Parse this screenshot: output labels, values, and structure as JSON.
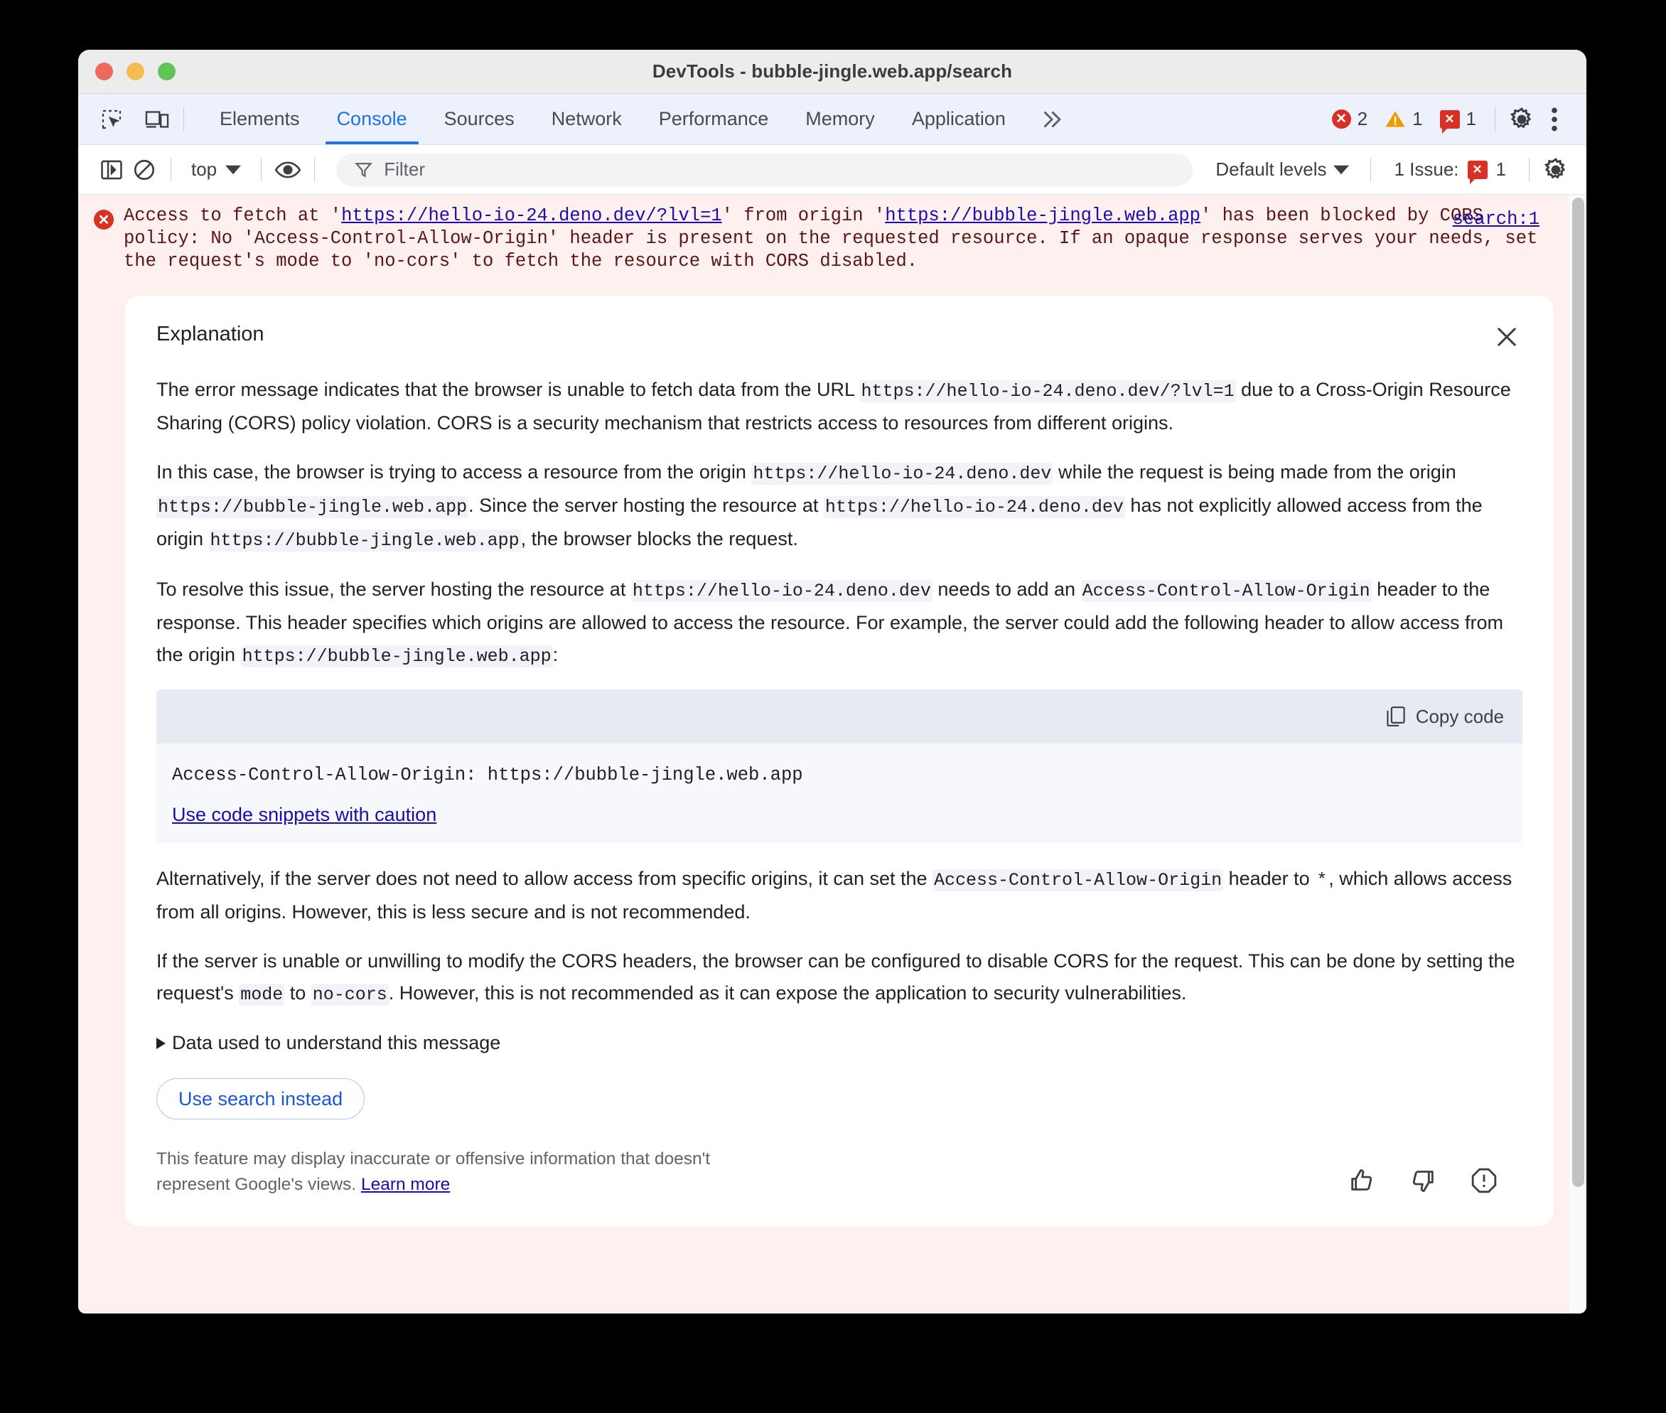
{
  "window": {
    "title": "DevTools - bubble-jingle.web.app/search",
    "traffic_lights": [
      "close",
      "minimize",
      "maximize"
    ]
  },
  "tabstrip": {
    "icons": [
      "inspect-element-icon",
      "device-toolbar-icon"
    ],
    "tabs": [
      {
        "label": "Elements",
        "active": false
      },
      {
        "label": "Console",
        "active": true
      },
      {
        "label": "Sources",
        "active": false
      },
      {
        "label": "Network",
        "active": false
      },
      {
        "label": "Performance",
        "active": false
      },
      {
        "label": "Memory",
        "active": false
      },
      {
        "label": "Application",
        "active": false
      }
    ],
    "more_label": "»",
    "counters": {
      "errors": "2",
      "warnings": "1",
      "issues": "1",
      "error_glyph": "✕",
      "issue_glyph": "✕"
    },
    "settings_label": "gear-icon",
    "overflow_label": "more-options-icon"
  },
  "console_toolbar": {
    "sidebar_toggle": "console-sidebar-icon",
    "clear_label": "clear-console-icon",
    "context": "top",
    "eye_label": "live-expressions-icon",
    "filter_placeholder": "Filter",
    "filter_value": "",
    "levels": "Default levels",
    "issues_text": "1 Issue:",
    "issues_count": "1",
    "settings_label": "settings-gear-icon"
  },
  "console_message": {
    "pre_url": "Access to fetch at '",
    "url": "https://hello-io-24.deno.dev/?lvl=1",
    "mid": "' from origin '",
    "origin": "https://bubble-jingle.web.app",
    "tail": "' has been blocked by CORS policy: No 'Access-Control-Allow-Origin' header is present on the requested resource. If an opaque response serves your needs, set the request's mode to 'no-cors' to fetch the resource with CORS disabled.",
    "source_link": "search:1"
  },
  "explanation": {
    "title": "Explanation",
    "close_label": "close-icon",
    "paragraphs": {
      "p1_a": "The error message indicates that the browser is unable to fetch data from the URL ",
      "p1_code": "https://hello-io-24.deno.dev/?lvl=1",
      "p1_b": " due to a Cross-Origin Resource Sharing (CORS) policy violation. CORS is a security mechanism that restricts access to resources from different origins.",
      "p2_a": "In this case, the browser is trying to access a resource from the origin ",
      "p2_code1": "https://hello-io-24.deno.dev",
      "p2_b": " while the request is being made from the origin ",
      "p2_code2": "https://bubble-jingle.web.app",
      "p2_c": ". Since the server hosting the resource at ",
      "p2_code3": "https://hello-io-24.deno.dev",
      "p2_d": " has not explicitly allowed access from the origin ",
      "p2_code4": "https://bubble-jingle.web.app",
      "p2_e": ", the browser blocks the request.",
      "p3_a": "To resolve this issue, the server hosting the resource at ",
      "p3_code1": "https://hello-io-24.deno.dev",
      "p3_b": " needs to add an ",
      "p3_code2": "Access-Control-Allow-Origin",
      "p3_c": " header to the response. This header specifies which origins are allowed to access the resource. For example, the server could add the following header to allow access from the origin ",
      "p3_code3": "https://bubble-jingle.web.app",
      "p3_d": ":",
      "p4_a": "Alternatively, if the server does not need to allow access from specific origins, it can set the ",
      "p4_code1": "Access-Control-Allow-Origin",
      "p4_b": " header to ",
      "p4_code2": "*",
      "p4_c": ", which allows access from all origins. However, this is less secure and is not recommended.",
      "p5_a": "If the server is unable or unwilling to modify the CORS headers, the browser can be configured to disable CORS for the request. This can be done by setting the request's ",
      "p5_code1": "mode",
      "p5_b": " to ",
      "p5_code2": "no-cors",
      "p5_c": ". However, this is not recommended as it can expose the application to security vulnerabilities."
    },
    "snippet": {
      "copy_label": "Copy code",
      "copy_icon": "copy-icon",
      "code": "Access-Control-Allow-Origin: https://bubble-jingle.web.app",
      "caution_link": "Use code snippets with caution"
    },
    "disclosure_label": "Data used to understand this message",
    "search_button": "Use search instead",
    "disclaimer_text": "This feature may display inaccurate or offensive information that doesn't represent Google's views. ",
    "disclaimer_link": "Learn more",
    "feedback": {
      "thumb_up": "thumb-up-icon",
      "thumb_down": "thumb-down-icon",
      "report": "report-icon"
    }
  }
}
